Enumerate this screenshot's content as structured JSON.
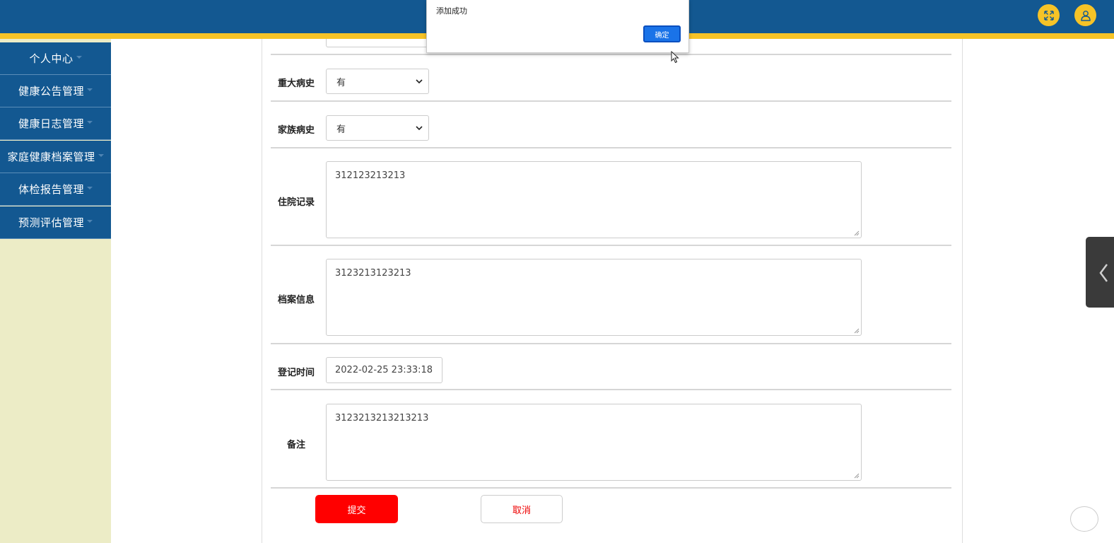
{
  "header": {
    "fullscreen_icon": "expand-icon",
    "user_icon": "user-icon",
    "colors": {
      "bar": "#135891",
      "stripe": "#f6c327"
    }
  },
  "sidebar": {
    "items": [
      {
        "label": "个人中心"
      },
      {
        "label": "健康公告管理"
      },
      {
        "label": "健康日志管理"
      },
      {
        "label": "家庭健康档案管理"
      },
      {
        "label": "体检报告管理"
      },
      {
        "label": "预测评估管理"
      }
    ]
  },
  "form": {
    "major_history": {
      "label": "重大病史",
      "value": "有"
    },
    "family_history": {
      "label": "家族病史",
      "value": "有"
    },
    "hospital_record": {
      "label": "住院记录",
      "value": "312123213213"
    },
    "archive_info": {
      "label": "档案信息",
      "value": "3123213123213"
    },
    "register_time": {
      "label": "登记时间",
      "value": "2022-02-25 23:33:18"
    },
    "remark": {
      "label": "备注",
      "value": "3123213213213213"
    },
    "submit_label": "提交",
    "cancel_label": "取消"
  },
  "alert": {
    "message": "添加成功",
    "ok_label": "确定"
  }
}
